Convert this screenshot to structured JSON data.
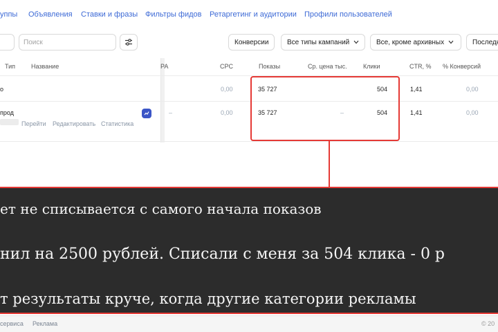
{
  "nav": {
    "tabs": [
      "уппы",
      "Объявления",
      "Ставки и фразы",
      "Фильтры фидов",
      "Ретаргетинг и аудитории",
      "Профили пользователей"
    ]
  },
  "toolbar": {
    "search_placeholder": "Поиск",
    "filter_icon": "sliders-icon",
    "pills": [
      "Конверсии",
      "Все типы кампаний",
      "Все, кроме архивных",
      "Последн"
    ]
  },
  "table": {
    "headers": {
      "type": "Тип",
      "name": "Название",
      "cpa": "PA",
      "cpc": "CPC",
      "shows": "Показы",
      "avg_price": "Ср. цена тыс.",
      "clicks": "Клики",
      "ctr": "CTR, %",
      "conv": "% Конверсий"
    },
    "rows": [
      {
        "name": "о",
        "cpc": "0,00",
        "shows": "35 727",
        "avg_price": "",
        "clicks": "504",
        "ctr": "1,41",
        "conv": "0,00"
      },
      {
        "name": "прод",
        "cpa": "–",
        "cpc": "0,00",
        "shows": "35 727",
        "avg_price": "–",
        "clicks": "504",
        "ctr": "1,41",
        "conv": "0,00",
        "links": [
          "Перейти",
          "Редактировать",
          "Статистика"
        ]
      }
    ]
  },
  "caption": {
    "lines": [
      "ет не списывается с самого начала показов",
      "нил на 2500 рублей. Списали с меня за 504 клика - 0 р",
      "т результаты круче, когда другие категории рекламы"
    ]
  },
  "footer": {
    "links": [
      "сервиса",
      "Реклама"
    ],
    "copyright": "© 20"
  },
  "colors": {
    "accent": "#3d6ad6",
    "highlight": "#e53935",
    "caption_bg": "#2c2c2c",
    "badge": "#3b55c7"
  }
}
